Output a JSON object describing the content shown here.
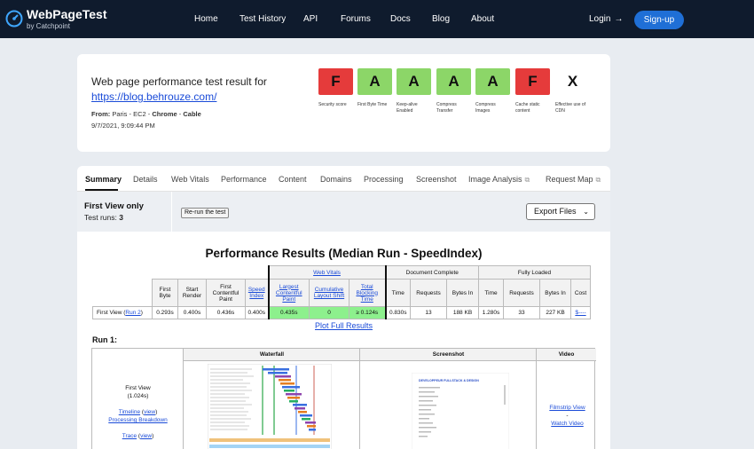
{
  "nav": {
    "brand": "WebPageTest",
    "brand_sub": "by Catchpoint",
    "links": [
      "Home",
      "Test History",
      "API",
      "Forums",
      "Docs",
      "Blog",
      "About"
    ],
    "login": "Login",
    "signup": "Sign-up"
  },
  "header": {
    "title": "Web page performance test result for",
    "url": "https://blog.behrouze.com/",
    "from_label": "From:",
    "from_location": "Paris - EC2 - ",
    "from_browser": "Chrome",
    "from_sep": " - ",
    "from_conn": "Cable",
    "date": "9/7/2021, 9:09:44 PM"
  },
  "grades": [
    {
      "grade": "F",
      "label": "Security score",
      "color": "#e53b3b"
    },
    {
      "grade": "A",
      "label": "First Byte Time",
      "color": "#8cd668"
    },
    {
      "grade": "A",
      "label": "Keep-alive Enabled",
      "color": "#8cd668"
    },
    {
      "grade": "A",
      "label": "Compress Transfer",
      "color": "#8cd668"
    },
    {
      "grade": "A",
      "label": "Compress Images",
      "color": "#8cd668"
    },
    {
      "grade": "F",
      "label": "Cache static content",
      "color": "#e53b3b"
    },
    {
      "grade": "X",
      "label": "Effective use of CDN",
      "color": "#ffffff"
    }
  ],
  "tabs": [
    {
      "label": "Summary",
      "active": true
    },
    {
      "label": "Details"
    },
    {
      "label": "Web Vitals"
    },
    {
      "label": "Performance"
    },
    {
      "label": "Content"
    },
    {
      "label": "Domains"
    },
    {
      "label": "Processing"
    },
    {
      "label": "Screenshot"
    },
    {
      "label": "Image Analysis",
      "external": true
    },
    {
      "label": "Request Map",
      "external": true
    }
  ],
  "summary": {
    "view_title": "First View only",
    "runs_label": "Test runs:",
    "runs_count": "3",
    "rerun": "Re-run the test",
    "export": "Export Files"
  },
  "perf": {
    "title": "Performance Results (Median Run - SpeedIndex)",
    "groups": {
      "vitals": "Web Vitals",
      "doc": "Document Complete",
      "full": "Fully Loaded"
    },
    "cols": {
      "first_byte": "First Byte",
      "start_render": "Start Render",
      "fcp": "First Contentful Paint",
      "speed_index": "Speed Index",
      "lcp": "Largest Contentful Paint",
      "cls": "Cumulative Layout Shift",
      "tbt": "Total Blocking Time",
      "time": "Time",
      "requests": "Requests",
      "bytes": "Bytes In",
      "cost": "Cost"
    },
    "row": {
      "label": "First View (",
      "run_link": "Run 2",
      "label_end": ")",
      "first_byte": "0.293s",
      "start_render": "0.400s",
      "fcp": "0.436s",
      "speed_index": "0.400s",
      "lcp": "0.435s",
      "cls": "0",
      "tbt": "≥ 0.124s",
      "doc_time": "0.830s",
      "doc_requests": "13",
      "doc_bytes": "188 KB",
      "full_time": "1.280s",
      "full_requests": "33",
      "full_bytes": "227 KB",
      "cost": "$----"
    },
    "plot_link": "Plot Full Results"
  },
  "run1": {
    "heading": "Run 1:",
    "cols": {
      "waterfall": "Waterfall",
      "screenshot": "Screenshot",
      "video": "Video"
    },
    "view": "First View",
    "time": "(1.024s)",
    "timeline": "Timeline",
    "view_link": "view",
    "processing": "Processing Breakdown",
    "trace": "Trace",
    "filmstrip": "Filmstrip View",
    "sep": "-",
    "watch": "Watch Video",
    "shot_title": "DEVELOPPEUR FULLSTACK & DESIGN"
  }
}
